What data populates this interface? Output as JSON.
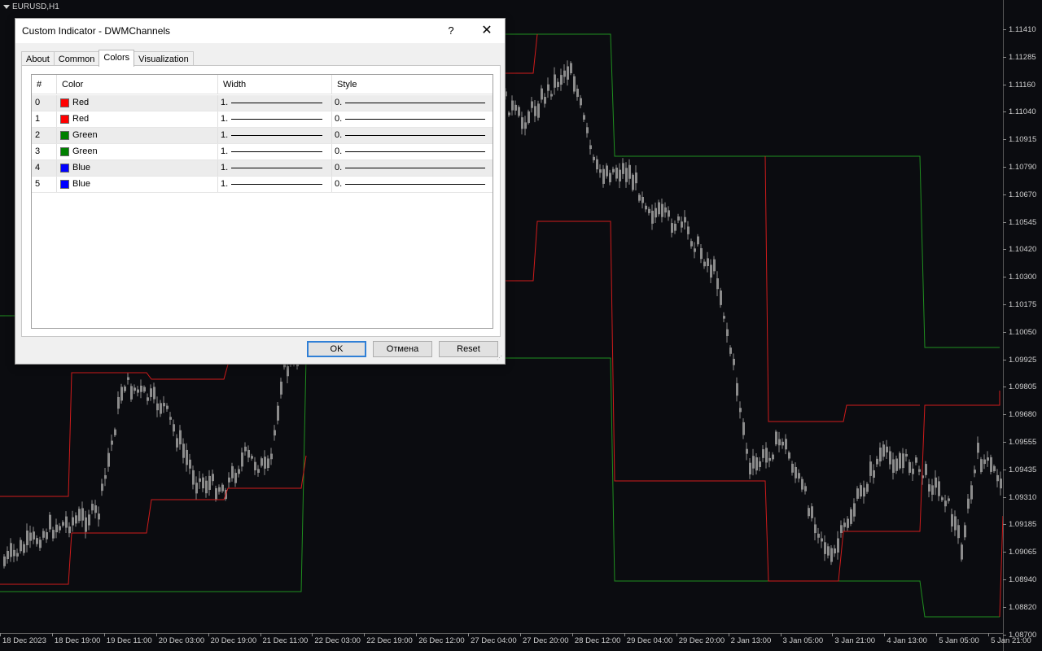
{
  "chart": {
    "symbol": "EURUSD,H1",
    "price_ticks": [
      "1.11410",
      "1.11285",
      "1.11160",
      "1.11040",
      "1.10915",
      "1.10790",
      "1.10670",
      "1.10545",
      "1.10420",
      "1.10300",
      "1.10175",
      "1.10050",
      "1.09925",
      "1.09805",
      "1.09680",
      "1.09555",
      "1.09435",
      "1.09310",
      "1.09185",
      "1.09065",
      "1.08940",
      "1.08820",
      "1.08700"
    ],
    "time_ticks": [
      "18 Dec 2023",
      "18 Dec 19:00",
      "19 Dec 11:00",
      "20 Dec 03:00",
      "20 Dec 19:00",
      "21 Dec 11:00",
      "22 Dec 03:00",
      "22 Dec 19:00",
      "26 Dec 12:00",
      "27 Dec 04:00",
      "27 Dec 20:00",
      "28 Dec 12:00",
      "29 Dec 04:00",
      "29 Dec 20:00",
      "2 Jan 13:00",
      "3 Jan 05:00",
      "3 Jan 21:00",
      "4 Jan 13:00",
      "5 Jan 05:00",
      "5 Jan 21:00"
    ],
    "colors": {
      "background": "#0b0c10",
      "candle": "#8c8c8c",
      "upper_channel": "#1f8f1f",
      "lower_channel": "#d01b1b"
    }
  },
  "dialog": {
    "title": "Custom Indicator - DWMChannels",
    "help_label": "?",
    "close_label": "✕",
    "tabs": [
      {
        "label": "About",
        "active": false
      },
      {
        "label": "Common",
        "active": false
      },
      {
        "label": "Colors",
        "active": true
      },
      {
        "label": "Visualization",
        "active": false
      }
    ],
    "grid": {
      "headers": {
        "index": "#",
        "color": "Color",
        "width": "Width",
        "style": "Style"
      },
      "rows": [
        {
          "index": "0",
          "color_name": "Red",
          "color_hex": "#ff0000",
          "width": "1.",
          "style": "0."
        },
        {
          "index": "1",
          "color_name": "Red",
          "color_hex": "#ff0000",
          "width": "1.",
          "style": "0."
        },
        {
          "index": "2",
          "color_name": "Green",
          "color_hex": "#008000",
          "width": "1.",
          "style": "0."
        },
        {
          "index": "3",
          "color_name": "Green",
          "color_hex": "#008000",
          "width": "1.",
          "style": "0."
        },
        {
          "index": "4",
          "color_name": "Blue",
          "color_hex": "#0000ff",
          "width": "1.",
          "style": "0."
        },
        {
          "index": "5",
          "color_name": "Blue",
          "color_hex": "#0000ff",
          "width": "1.",
          "style": "0."
        }
      ]
    },
    "buttons": {
      "ok": "OK",
      "cancel": "Отмена",
      "reset": "Reset"
    }
  }
}
